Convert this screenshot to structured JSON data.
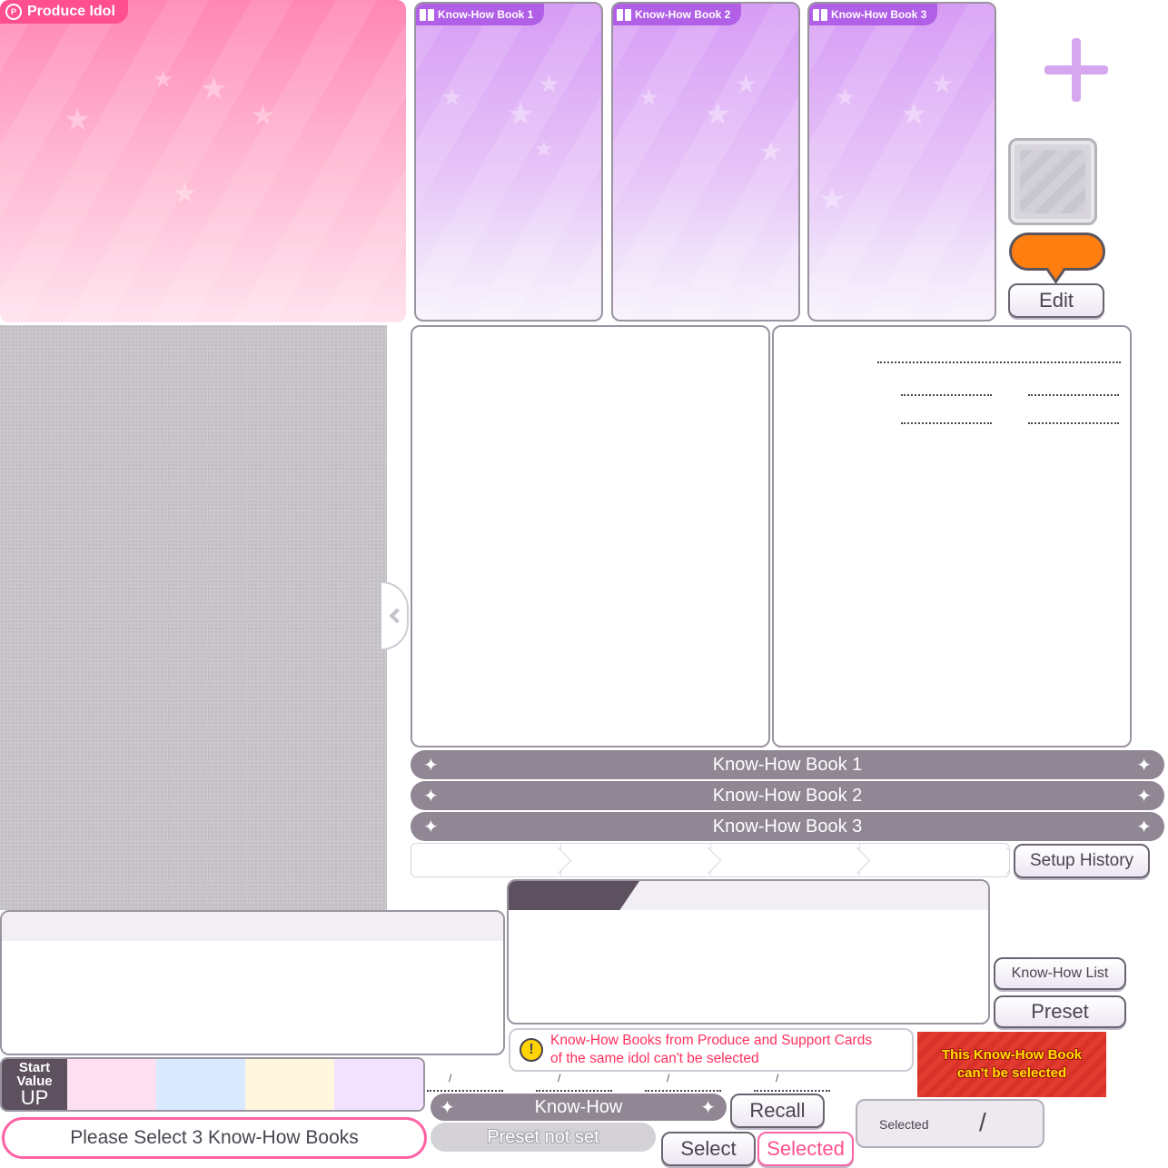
{
  "idol_card": {
    "label": "Produce Idol",
    "icon": "produce-p-icon",
    "colors": {
      "label_bg": "#ff4f8f",
      "top": "#ff86b4",
      "bottom": "#ffe3ee"
    }
  },
  "book_cards": [
    {
      "label": "Know-How Book 1",
      "icon": "book-icon"
    },
    {
      "label": "Know-How Book 2",
      "icon": "book-icon"
    },
    {
      "label": "Know-How Book 3",
      "icon": "book-icon"
    }
  ],
  "side_controls": {
    "add_icon": "plus-icon",
    "edit_label": "Edit",
    "bubble_color": "#ff7e10"
  },
  "book_bars": [
    {
      "label": "Know-How Book 1"
    },
    {
      "label": "Know-How Book 2"
    },
    {
      "label": "Know-How Book 3"
    }
  ],
  "setup_history_label": "Setup History",
  "knowhow_list_label": "Know-How List",
  "preset_label": "Preset",
  "warning": {
    "line1": "Know-How Books from Produce and Support Cards",
    "line2": "of the same idol can't be selected",
    "icon": "exclamation"
  },
  "not_selectable": {
    "line1": "This Know-How Book",
    "line2": "can't be selected"
  },
  "start_value": {
    "label_line1": "Start",
    "label_line2": "Value",
    "label_line3": "UP",
    "colors": [
      "#ffe0f0",
      "#d9e9ff",
      "#fff6dd",
      "#f2e2ff"
    ]
  },
  "select_prompt": "Please Select 3 Know-How Books",
  "slash": "/",
  "knowhow_bar_label": "Know-How",
  "preset_not_set": "Preset not set",
  "recall_label": "Recall",
  "select_label": "Select",
  "selected_label": "Selected",
  "selected_count": {
    "label": "Selected",
    "separator": "/"
  },
  "accent_colors": {
    "pink": "#ff4f8f",
    "purple": "#b05fe6",
    "bar_gray": "#908694",
    "warning_red": "#ff2f5d"
  }
}
